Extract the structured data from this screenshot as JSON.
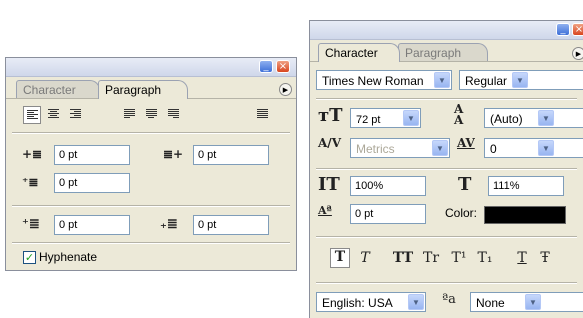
{
  "paragraph_panel": {
    "tabs": {
      "character": "Character",
      "paragraph": "Paragraph"
    },
    "indent_left": "0 pt",
    "indent_right": "0 pt",
    "indent_first_line": "0 pt",
    "space_before": "0 pt",
    "space_after": "0 pt",
    "hyphenate_label": "Hyphenate",
    "hyphenate_checked": true
  },
  "character_panel": {
    "tabs": {
      "character": "Character",
      "paragraph": "Paragraph"
    },
    "font_family": "Times New Roman",
    "font_style": "Regular",
    "font_size": "72 pt",
    "leading": "(Auto)",
    "kerning": "Metrics",
    "tracking": "0",
    "vertical_scale": "100%",
    "horizontal_scale": "111%",
    "baseline_shift": "0 pt",
    "color_label": "Color:",
    "color_value": "#000000",
    "language": "English: USA",
    "anti_alias": "None",
    "type_buttons": [
      "T",
      "T",
      "TT",
      "Tr",
      "T¹",
      "T₁",
      "T",
      "Ŧ"
    ]
  },
  "window_controls": {
    "minimize": "_",
    "close": "×"
  },
  "colors": {
    "panel_bg": "#ece9d8",
    "field_border": "#7f9db9",
    "tab_inactive_text": "#7a7a7a"
  }
}
